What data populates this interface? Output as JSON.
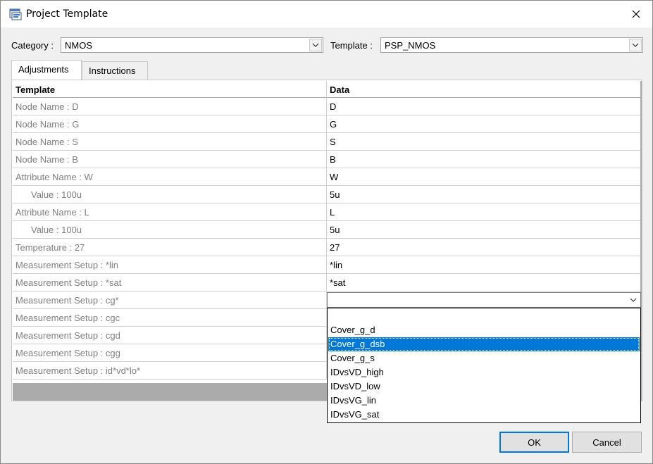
{
  "window": {
    "title": "Project Template"
  },
  "category": {
    "label": "Category :",
    "value": "NMOS"
  },
  "template": {
    "label": "Template :",
    "value": "PSP_NMOS"
  },
  "tabs": [
    {
      "label": "Adjustments",
      "active": true
    },
    {
      "label": "Instructions",
      "active": false
    }
  ],
  "grid": {
    "headers": [
      "Template",
      "Data"
    ],
    "rows": [
      {
        "template": "Node Name : D",
        "data": "D",
        "indent": false
      },
      {
        "template": "Node Name : G",
        "data": "G",
        "indent": false
      },
      {
        "template": "Node Name : S",
        "data": "S",
        "indent": false
      },
      {
        "template": "Node Name : B",
        "data": "B",
        "indent": false
      },
      {
        "template": "Attribute Name : W",
        "data": "W",
        "indent": false
      },
      {
        "template": "Value : 100u",
        "data": "5u",
        "indent": true
      },
      {
        "template": "Attribute Name : L",
        "data": "L",
        "indent": false
      },
      {
        "template": "Value : 100u",
        "data": "5u",
        "indent": true
      },
      {
        "template": "Temperature : 27",
        "data": "27",
        "indent": false
      },
      {
        "template": "Measurement Setup : *lin",
        "data": "*lin",
        "indent": false
      },
      {
        "template": "Measurement Setup : *sat",
        "data": "*sat",
        "indent": false
      },
      {
        "template": "Measurement Setup : cg*",
        "data": "",
        "indent": false
      },
      {
        "template": "Measurement Setup : cgc",
        "data": "",
        "indent": false
      },
      {
        "template": "Measurement Setup : cgd",
        "data": "",
        "indent": false
      },
      {
        "template": "Measurement Setup : cgg",
        "data": "",
        "indent": false
      },
      {
        "template": "Measurement Setup : id*vd*lo*",
        "data": "",
        "indent": false
      }
    ]
  },
  "dropdown": {
    "options": [
      "",
      "Cover_g_d",
      "Cover_g_dsb",
      "Cover_g_s",
      "IDvsVD_high",
      "IDvsVD_low",
      "IDvsVG_lin",
      "IDvsVG_sat"
    ],
    "selected": "Cover_g_dsb"
  },
  "buttons": {
    "ok": "OK",
    "cancel": "Cancel"
  },
  "colors": {
    "selection": "#0078d7",
    "disabled_text": "#808080"
  }
}
